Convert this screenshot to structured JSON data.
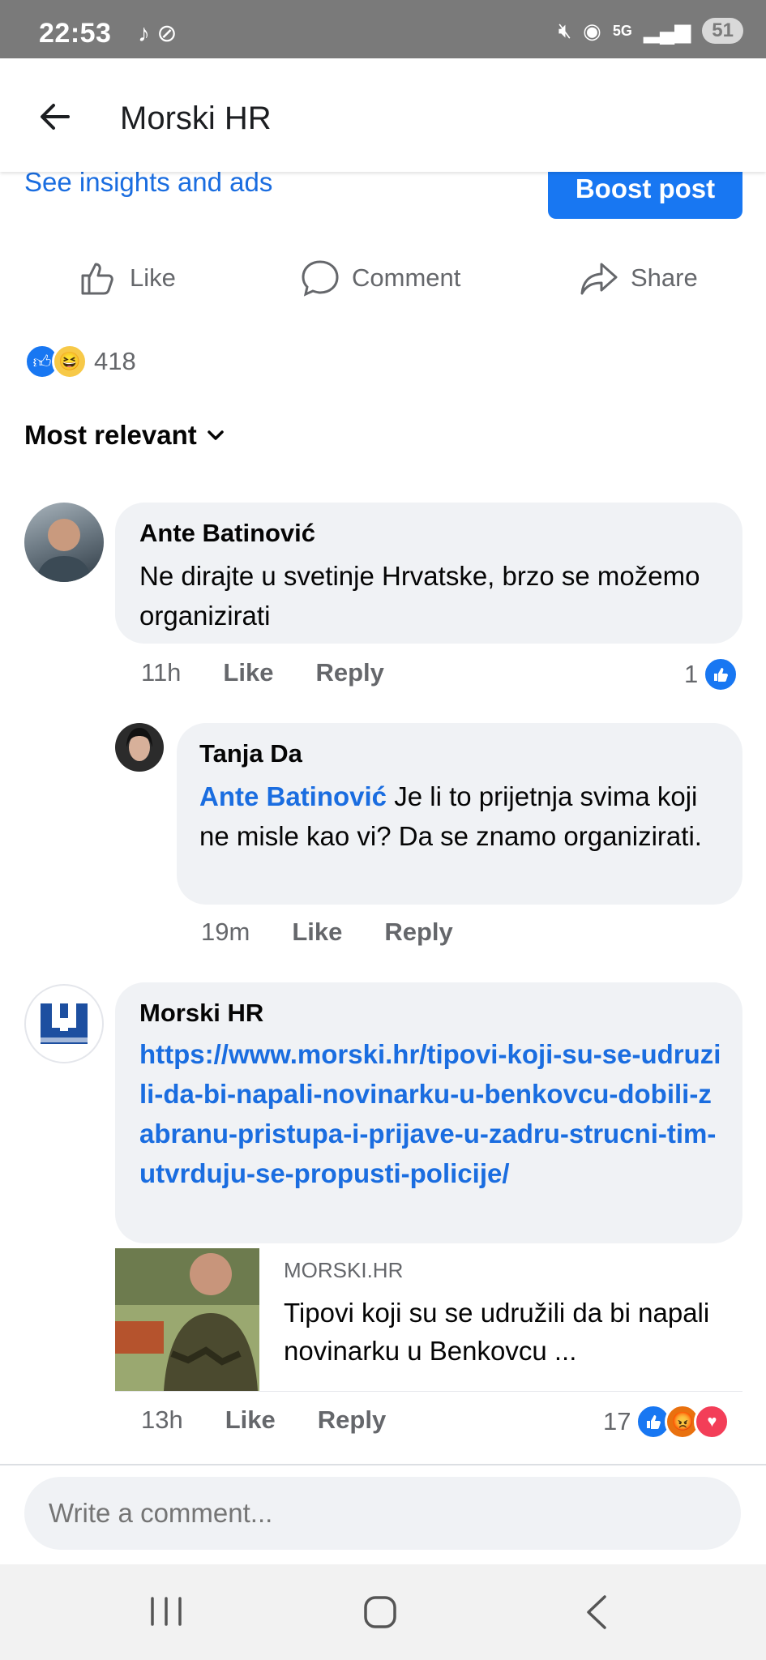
{
  "status": {
    "time": "22:53",
    "network": "5G",
    "battery": "51"
  },
  "header": {
    "title": "Morski HR"
  },
  "post": {
    "insights_label": "See insights and ads",
    "boost_label": "Boost post"
  },
  "actions": {
    "like": "Like",
    "comment": "Comment",
    "share": "Share"
  },
  "reactions": {
    "count": "418"
  },
  "sort": {
    "label": "Most relevant"
  },
  "comments": [
    {
      "author": "Ante Batinović",
      "text": "Ne dirajte u svetinje Hrvatske, brzo se možemo organizirati",
      "time": "11h",
      "like_label": "Like",
      "reply_label": "Reply",
      "reactions": "1"
    },
    {
      "author": "Tanja Da",
      "mention": "Ante Batinović",
      "text": "Je li to prijetnja svima koji ne misle kao vi? Da se znamo organizirati.",
      "time": "19m",
      "like_label": "Like",
      "reply_label": "Reply"
    },
    {
      "author": "Morski HR",
      "link": "https://www.morski.hr/tipovi-koji-su-se-udruzili-da-bi-napali-novinarku-u-benkovcu-dobili-zabranu-pristupa-i-prijave-u-zadru-strucni-tim-utvrduju-se-propusti-policije/",
      "preview_domain": "MORSKI.HR",
      "preview_title": "Tipovi koji su se udružili da bi napali novinarku u Benkovcu ...",
      "time": "13h",
      "like_label": "Like",
      "reply_label": "Reply",
      "reactions": "17"
    }
  ],
  "composer": {
    "placeholder": "Write a comment..."
  },
  "colors": {
    "accent": "#1877f2",
    "link": "#1a6de0",
    "bubble": "#f0f2f5",
    "muted": "#65676b"
  }
}
